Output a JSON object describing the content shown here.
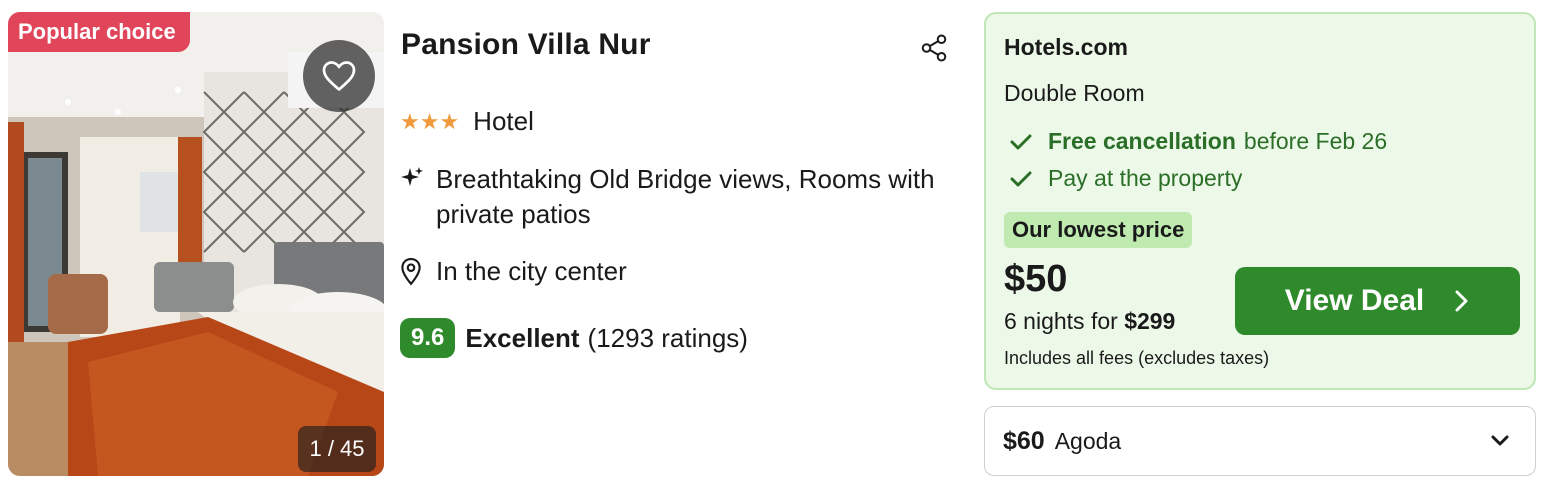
{
  "photo": {
    "badge": "Popular choice",
    "counter": "1 / 45",
    "favorite_icon": "heart-icon"
  },
  "hotel": {
    "name": "Pansion Villa Nur",
    "stars": "★★★",
    "type": "Hotel",
    "highlights": "Breathtaking Old Bridge views, Rooms with private patios",
    "location": "In the city center",
    "score": "9.6",
    "rating_word": "Excellent",
    "rating_count": "(1293 ratings)"
  },
  "deal": {
    "provider": "Hotels.com",
    "room_type": "Double Room",
    "free_cancel_strong": "Free cancellation",
    "free_cancel_rest": "before Feb 26",
    "pay_at_property": "Pay at the property",
    "lowest_badge": "Our lowest price",
    "price": "$50",
    "nights_prefix": "6 nights for",
    "nights_total": "$299",
    "fees_note": "Includes all fees (excludes taxes)",
    "button_label": "View Deal"
  },
  "other_offer": {
    "price": "$60",
    "provider": "Agoda"
  },
  "colors": {
    "accent_green": "#2f8a2b",
    "panel_bg": "#edf9e8",
    "badge_red": "#e0455a",
    "star_orange": "#f09a3e"
  }
}
